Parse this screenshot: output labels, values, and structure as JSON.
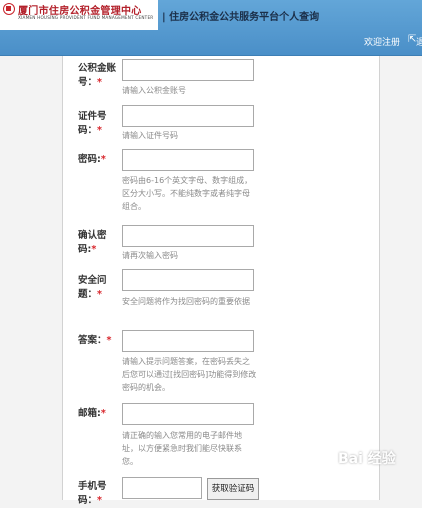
{
  "header": {
    "logo_cn": "厦门市住房公积金管理中心",
    "logo_en": "XIAMEN HOUSING PROVIDENT FUND MANAGEMENT CENTER",
    "title": "| 住房公积金公共服务平台个人查询",
    "welcome_register": "欢迎注册",
    "exit_text": "退"
  },
  "form": {
    "fields": [
      {
        "label": "公积金账号：",
        "required": "*",
        "value": "",
        "hint": "请输入公积金账号"
      },
      {
        "label": "证件号码：",
        "required": "*",
        "value": "",
        "hint": "请输入证件号码"
      },
      {
        "label": "密码:",
        "required": "*",
        "value": "",
        "hint": "密码由6-16个英文字母、数字组成，区分大小写。不能纯数字或者纯字母组合。"
      },
      {
        "label": "确认密码:",
        "required": "*",
        "value": "",
        "hint": "请再次输入密码"
      },
      {
        "label": "安全问题：",
        "required": "*",
        "value": "",
        "hint": "安全问题将作为找回密码的重要依据"
      },
      {
        "label": "答案：",
        "required": "*",
        "value": "",
        "hint": "请输入提示问题答案，在密码丢失之后您可以通过[找回密码]功能得到修改密码的机会。"
      },
      {
        "label": "邮箱:",
        "required": "*",
        "value": "",
        "hint": "请正确的输入您常用的电子邮件地址，以方便紧急时我们能尽快联系您。"
      },
      {
        "label": "手机号码：",
        "required": "*",
        "value": ""
      }
    ],
    "sms_button": "获取验证码"
  },
  "watermark": "Bai 经验"
}
